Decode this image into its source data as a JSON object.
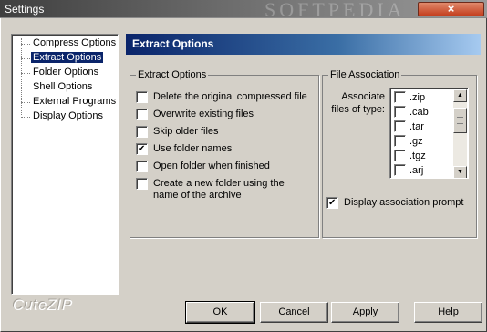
{
  "window": {
    "title": "Settings",
    "watermark": "SOFTPEDIA",
    "close_label": "×"
  },
  "tree": {
    "items": [
      {
        "label": "Compress Options",
        "selected": false
      },
      {
        "label": "Extract Options",
        "selected": true
      },
      {
        "label": "Folder Options",
        "selected": false
      },
      {
        "label": "Shell Options",
        "selected": false
      },
      {
        "label": "External Programs",
        "selected": false
      },
      {
        "label": "Display Options",
        "selected": false
      }
    ]
  },
  "brand": "CuteZIP",
  "panel": {
    "header": "Extract Options",
    "extract_group": {
      "legend": "Extract Options",
      "options": [
        {
          "label": "Delete the original compressed file",
          "checked": false
        },
        {
          "label": "Overwrite existing files",
          "checked": false
        },
        {
          "label": "Skip older files",
          "checked": false
        },
        {
          "label": "Use folder names",
          "checked": true
        },
        {
          "label": "Open folder when finished",
          "checked": false
        },
        {
          "label": "Create a new folder using the name of the archive",
          "checked": false
        }
      ]
    },
    "assoc_group": {
      "legend": "File Association",
      "associate_label": "Associate files of type:",
      "types": [
        {
          "label": ".zip",
          "checked": false
        },
        {
          "label": ".cab",
          "checked": false
        },
        {
          "label": ".tar",
          "checked": false
        },
        {
          "label": ".gz",
          "checked": false
        },
        {
          "label": ".tgz",
          "checked": false
        },
        {
          "label": ".arj",
          "checked": false
        }
      ],
      "display_prompt": {
        "label": "Display association prompt",
        "checked": true
      }
    }
  },
  "buttons": {
    "ok": "OK",
    "cancel": "Cancel",
    "apply": "Apply",
    "help": "Help"
  }
}
